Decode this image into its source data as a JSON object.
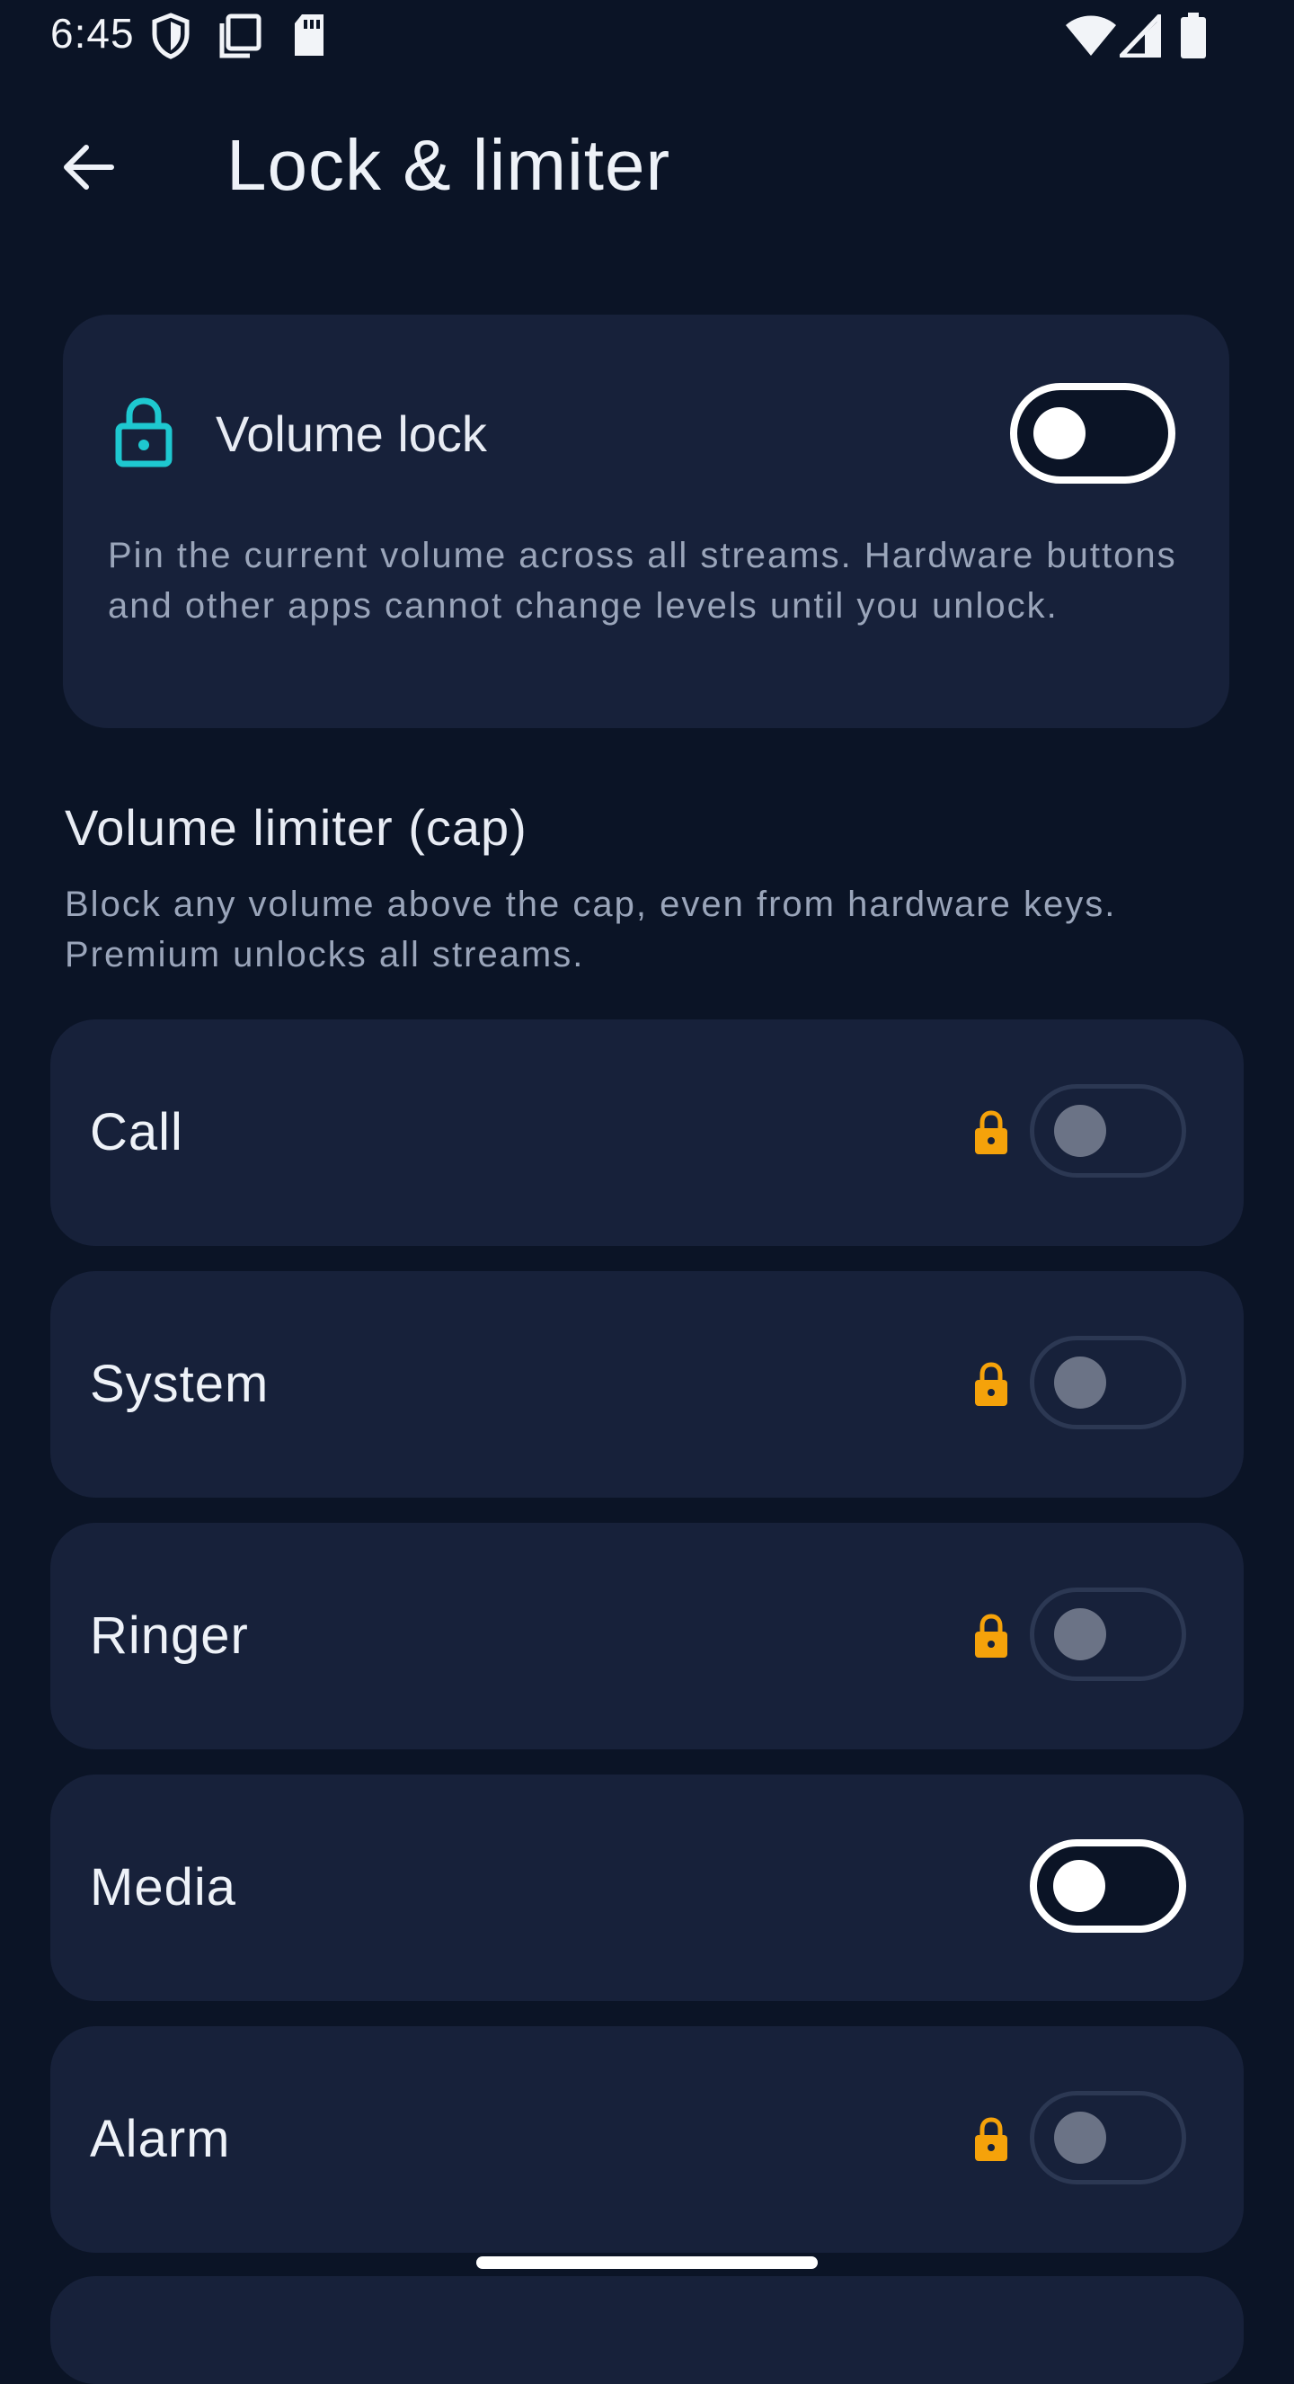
{
  "status_bar": {
    "time": "6:45"
  },
  "header": {
    "title": "Lock & limiter"
  },
  "volume_lock": {
    "label": "Volume lock",
    "enabled": false,
    "description": "Pin the current volume across all streams. Hardware buttons and other apps cannot change levels until you unlock."
  },
  "limiter": {
    "title": "Volume limiter (cap)",
    "description": "Block any volume above the cap, even from hardware keys. Premium unlocks all streams.",
    "streams": [
      {
        "label": "Call",
        "premium_locked": true,
        "enabled": false
      },
      {
        "label": "System",
        "premium_locked": true,
        "enabled": false
      },
      {
        "label": "Ringer",
        "premium_locked": true,
        "enabled": false
      },
      {
        "label": "Media",
        "premium_locked": false,
        "enabled": false
      },
      {
        "label": "Alarm",
        "premium_locked": true,
        "enabled": false
      }
    ]
  },
  "colors": {
    "background": "#0b1426",
    "card": "#17213a",
    "accent_teal": "#1ec8d0",
    "premium_lock": "#f5a20a",
    "secondary_text": "#9aa5ba"
  },
  "icons": {
    "back": "arrow-left-icon",
    "volume_lock": "lock-icon",
    "premium": "lock-icon"
  }
}
